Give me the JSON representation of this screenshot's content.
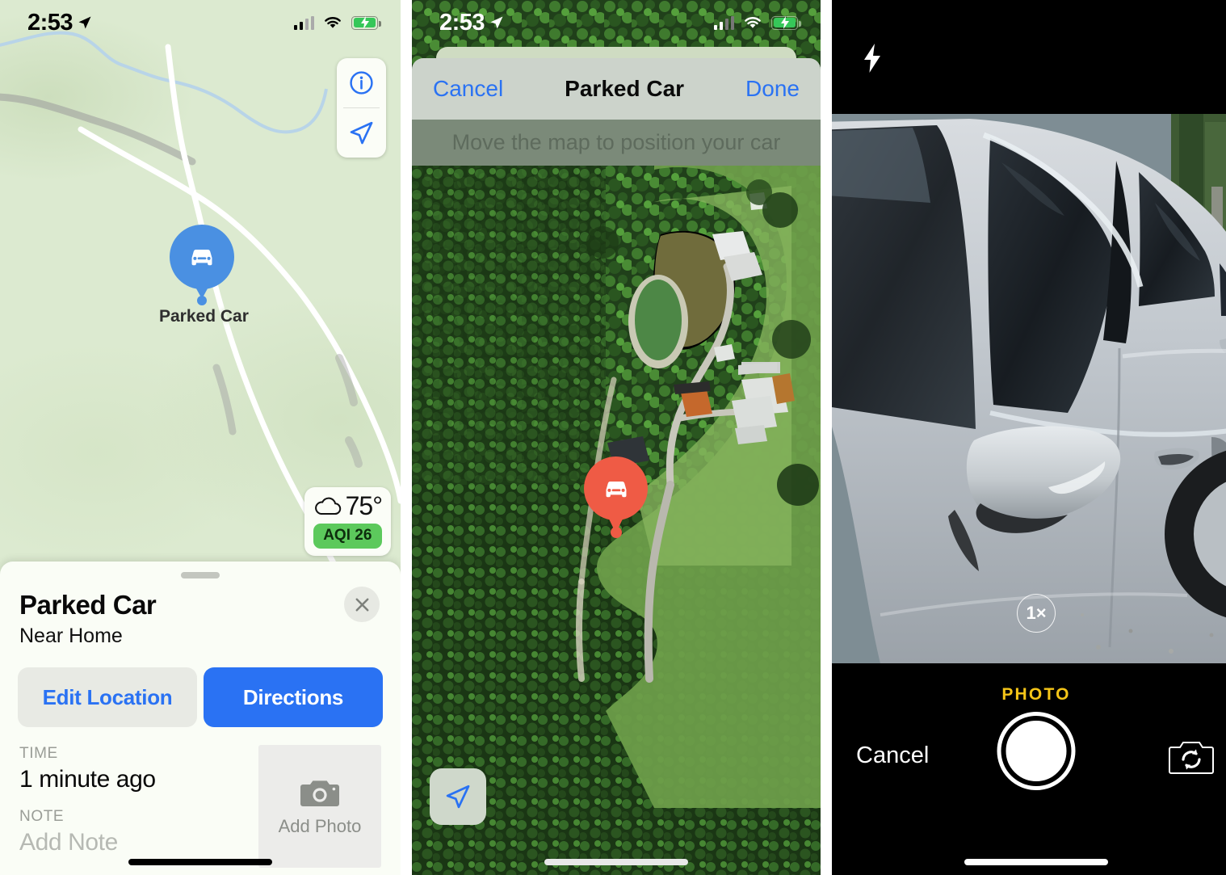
{
  "status_bar": {
    "time": "2:53",
    "location_arrow_icon": "location-arrow-icon",
    "cellular_icon": "signal-bars-icon",
    "wifi_icon": "wifi-icon",
    "battery_icon": "battery-charging-icon"
  },
  "maps_panel": {
    "controls": {
      "info_icon": "info-circle-icon",
      "locate_icon": "location-arrow-icon"
    },
    "pin": {
      "icon": "car-icon",
      "label": "Parked Car",
      "color": "#4a90e2"
    },
    "weather": {
      "condition_icon": "cloud-icon",
      "temperature": "75°",
      "aqi_label": "AQI 26",
      "aqi_color": "#5cc95c"
    },
    "sheet": {
      "title": "Parked Car",
      "subtitle": "Near Home",
      "close_icon": "close-x-icon",
      "edit_location_label": "Edit Location",
      "directions_label": "Directions",
      "time_label": "TIME",
      "time_value": "1 minute ago",
      "note_label": "NOTE",
      "note_value": "Add Note",
      "add_photo_label": "Add Photo",
      "add_photo_icon": "camera-icon"
    }
  },
  "edit_panel": {
    "modal": {
      "cancel_label": "Cancel",
      "title": "Parked Car",
      "done_label": "Done"
    },
    "hint": "Move the map to position your car",
    "pin": {
      "icon": "car-icon",
      "color": "#ef5b45"
    },
    "locate_icon": "location-arrow-icon"
  },
  "camera_panel": {
    "flash_icon": "flash-bolt-icon",
    "zoom_level": "1×",
    "mode_label": "PHOTO",
    "cancel_label": "Cancel",
    "shutter_icon": "shutter-button-icon",
    "flip_camera_icon": "camera-flip-icon",
    "mode_color": "#f5c518"
  }
}
